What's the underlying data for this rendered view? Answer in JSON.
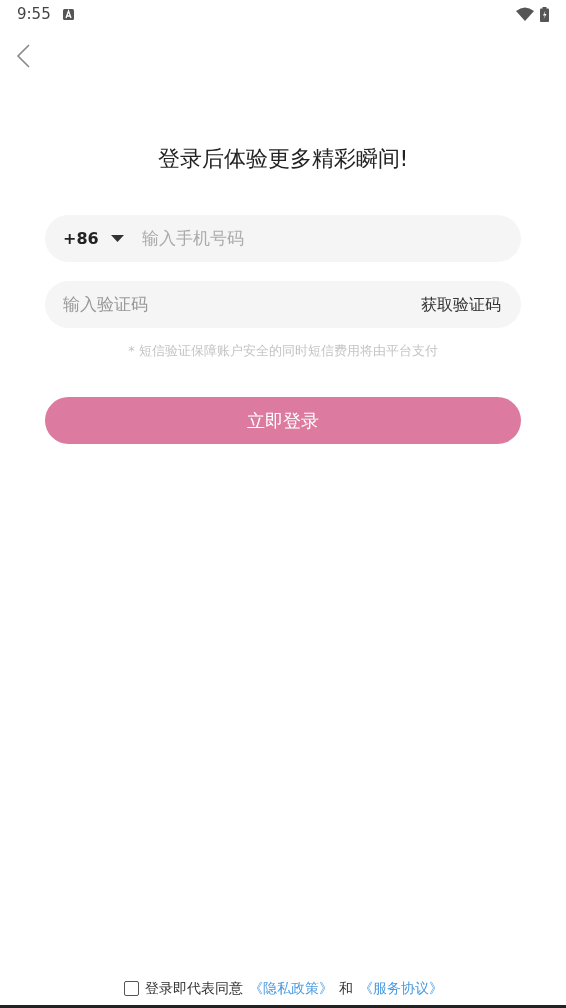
{
  "status_bar": {
    "time": "9:55"
  },
  "title": "登录后体验更多精彩瞬间!",
  "phone_field": {
    "country_code": "+86",
    "placeholder": "输入手机号码"
  },
  "code_field": {
    "placeholder": "输入验证码",
    "action": "获取验证码"
  },
  "note": "* 短信验证保障账户安全的同时短信费用将由平台支付",
  "login_button": "立即登录",
  "agreement": {
    "checked": false,
    "text": "登录即代表同意",
    "link_1": "《隐私政策》",
    "joiner": "和",
    "link_2": "《服务协议》"
  }
}
